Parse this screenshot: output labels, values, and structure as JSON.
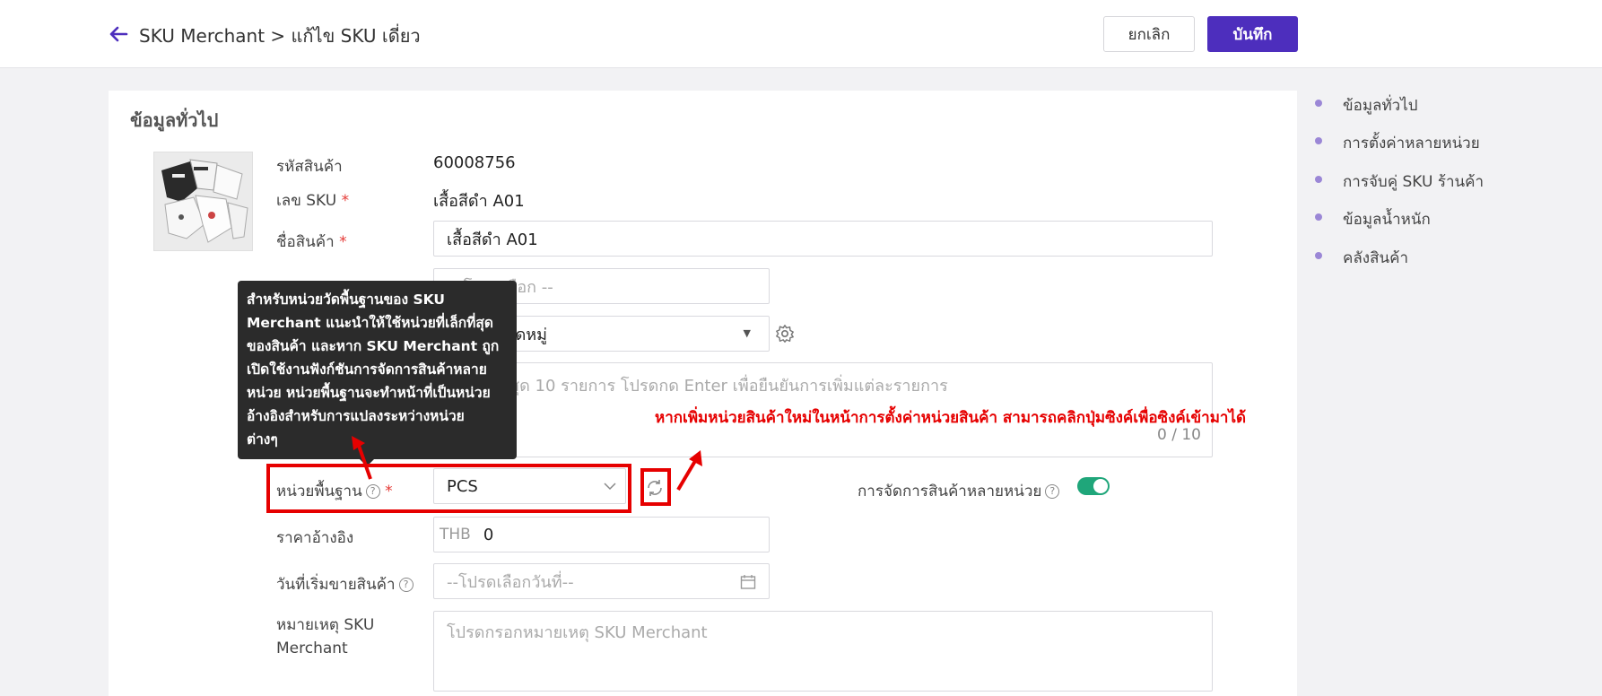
{
  "header": {
    "breadcrumb": "SKU Merchant > แก้ไข SKU เดี่ยว",
    "cancel_label": "ยกเลิก",
    "save_label": "บันทึก"
  },
  "section": {
    "title": "ข้อมูลทั่วไป"
  },
  "form": {
    "product_code_label": "รหัสสินค้า",
    "product_code_value": "60008756",
    "sku_label": "เลข SKU",
    "sku_value": "เสื้อสีดำ A01",
    "name_label": "ชื่อสินค้า",
    "name_value": "เสื้อสีดำ A01",
    "spu_placeholder": "-- โปรดเลือก --",
    "category_value": "ไม่มีหมวดหมู่",
    "gtin_placeholder": "รองรับสูงสุด 10 รายการ โปรดกด Enter เพื่อยืนยันการเพิ่มแต่ละรายการ",
    "gtin_count": "0 / 10",
    "base_unit_label": "หน่วยพื้นฐาน",
    "base_unit_value": "PCS",
    "multi_unit_label": "การจัดการสินค้าหลายหน่วย",
    "multi_unit_enabled": true,
    "ref_price_label": "ราคาอ้างอิง",
    "ref_price_currency": "THB",
    "ref_price_value": "0",
    "start_date_label": "วันที่เริ่มขายสินค้า",
    "start_date_placeholder": "--โปรดเลือกวันที่--",
    "note_label_1": "หมายเหตุ SKU",
    "note_label_2": "Merchant",
    "note_placeholder": "โปรดกรอกหมายเหตุ SKU Merchant"
  },
  "tooltip": {
    "lines": [
      "สำหรับหน่วยวัดพื้นฐานของ SKU",
      "Merchant แนะนำให้ใช้หน่วยที่เล็กที่สุด",
      "ของสินค้า และหาก SKU Merchant ถูก",
      "เปิดใช้งานฟังก์ชันการจัดการสินค้าหลาย",
      "หน่วย หน่วยพื้นฐานจะทำหน้าที่เป็นหน่วย",
      "อ้างอิงสำหรับการแปลงระหว่างหน่วย",
      "ต่างๆ"
    ]
  },
  "annotation": "หากเพิ่มหน่วยสินค้าใหม่ในหน้าการตั้งค่าหน่วยสินค้า สามารถคลิกปุ่มซิงค์เพื่อซิงค์เข้ามาได้",
  "right_nav": [
    "ข้อมูลทั่วไป",
    "การตั้งค่าหลายหน่วย",
    "การจับคู่ SKU ร้านค้า",
    "ข้อมูลน้ำหนัก",
    "คลังสินค้า"
  ],
  "colors": {
    "primary": "#4d2ebd",
    "toggle": "#1fa67a",
    "annotation": "#e60000",
    "nav_dot": "#9b87d6"
  }
}
